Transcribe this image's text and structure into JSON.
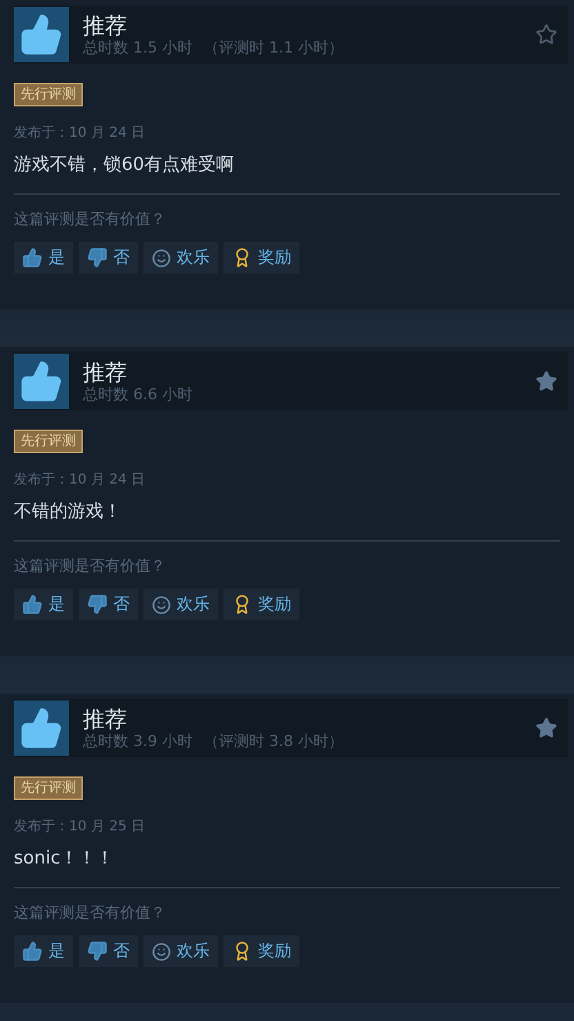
{
  "reviews": [
    {
      "verdict": "推荐",
      "hours": "总时数 1.5 小时",
      "review_hours": "（评测时 1.1 小时）",
      "starred": false,
      "tag": "先行评测",
      "posted": "发布于：10 月 24 日",
      "text": "游戏不错，锁60有点难受啊",
      "question": "这篇评测是否有价值？",
      "buttons": [
        {
          "kind": "yes",
          "label": "是"
        },
        {
          "kind": "no",
          "label": "否"
        },
        {
          "kind": "funny",
          "label": "欢乐"
        },
        {
          "kind": "award",
          "label": "奖励"
        }
      ]
    },
    {
      "verdict": "推荐",
      "hours": "总时数 6.6 小时",
      "starred": true,
      "tag": "先行评测",
      "posted": "发布于：10 月 24 日",
      "text": "不错的游戏！",
      "question": "这篇评测是否有价值？",
      "buttons": [
        {
          "kind": "yes",
          "label": "是"
        },
        {
          "kind": "no",
          "label": "否"
        },
        {
          "kind": "funny",
          "label": "欢乐"
        },
        {
          "kind": "award",
          "label": "奖励"
        }
      ]
    },
    {
      "verdict": "推荐",
      "hours": "总时数 3.9 小时",
      "review_hours": "（评测时 3.8 小时）",
      "starred": true,
      "tag": "先行评测",
      "posted": "发布于：10 月 25 日",
      "text": "sonic！！！",
      "question": "这篇评测是否有价值？",
      "buttons": [
        {
          "kind": "yes",
          "label": "是"
        },
        {
          "kind": "no",
          "label": "否"
        },
        {
          "kind": "funny",
          "label": "欢乐"
        },
        {
          "kind": "award",
          "label": "奖励"
        }
      ]
    }
  ]
}
